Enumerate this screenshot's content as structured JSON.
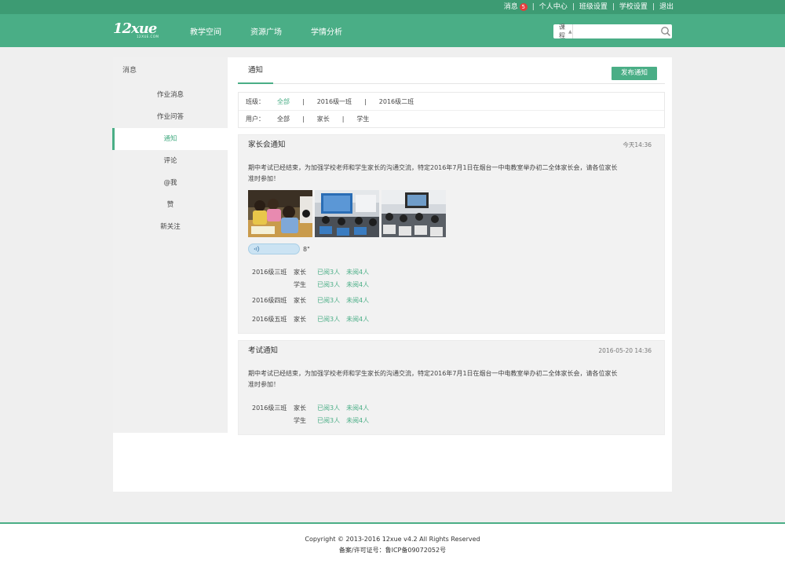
{
  "topbar": {
    "messages_label": "消息",
    "messages_count": "5",
    "links": [
      "个人中心",
      "班级设置",
      "学校设置",
      "退出"
    ]
  },
  "header": {
    "logo_text": "12xue",
    "logo_sub": "12XUE.COM",
    "nav": [
      "教学空间",
      "资源广场",
      "学情分析"
    ],
    "search": {
      "scope": "课程",
      "placeholder": ""
    }
  },
  "sidebar": {
    "title": "消息",
    "items": [
      "作业消息",
      "作业问答",
      "通知",
      "评论",
      "@我",
      "赞",
      "新关注"
    ],
    "active_index": 2
  },
  "content": {
    "tab": "通知",
    "publish_label": "发布通知",
    "filters": {
      "class_label": "班级：",
      "class_options": [
        "全部",
        "2016级一班",
        "2016级二班"
      ],
      "user_label": "用户：",
      "user_options": [
        "全部",
        "家长",
        "学生"
      ]
    },
    "notices": [
      {
        "title": "家长会通知",
        "time": "今天14:36",
        "body_line1": "期中考试已经结束，为加强学校老师和学生家长的沟通交流，特定2016年7月1日在烟台一中电教室举办初二全体家长会，请各位家长",
        "body_line2": "准时参加！",
        "voice_length": "8\"",
        "stats": [
          {
            "cls": "2016级三班",
            "role": "家长",
            "read": "已阅3人",
            "unread": "未阅4人"
          },
          {
            "cls": "",
            "role": "学生",
            "read": "已阅3人",
            "unread": "未阅4人"
          },
          {
            "cls": "2016级四班",
            "role": "家长",
            "read": "已阅3人",
            "unread": "未阅4人"
          },
          {
            "cls": "2016级五班",
            "role": "家长",
            "read": "已阅3人",
            "unread": "未阅4人"
          }
        ]
      },
      {
        "title": "考试通知",
        "time": "2016-05-20 14:36",
        "body_line1": "期中考试已经结束，为加强学校老师和学生家长的沟通交流，特定2016年7月1日在烟台一中电教室举办初二全体家长会，请各位家长",
        "body_line2": "准时参加！",
        "stats": [
          {
            "cls": "2016级三班",
            "role": "家长",
            "read": "已阅3人",
            "unread": "未阅4人"
          },
          {
            "cls": "",
            "role": "学生",
            "read": "已阅3人",
            "unread": "未阅4人"
          }
        ]
      }
    ]
  },
  "footer": {
    "copyright": "Copyright © 2013-2016 12xue v4.2 All Rights Reserved",
    "icp": "备案/许可证号：鲁ICP备09072052号"
  },
  "colors": {
    "brand": "#4aae86",
    "brand_dark": "#3d9b73",
    "badge": "#e53c3c"
  }
}
